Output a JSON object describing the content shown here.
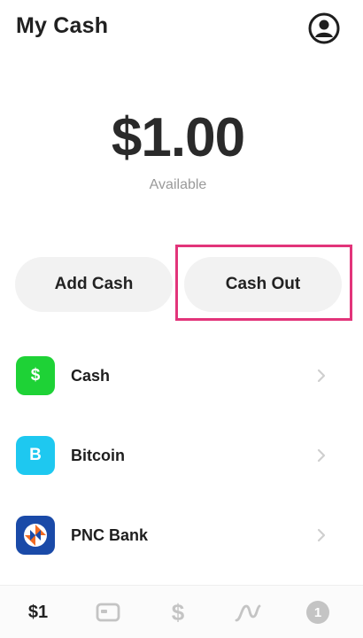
{
  "header": {
    "title": "My Cash",
    "profile_icon": "profile-icon"
  },
  "balance": {
    "amount": "$1.00",
    "label": "Available"
  },
  "actions": {
    "add_cash": "Add Cash",
    "cash_out": "Cash Out",
    "highlight_color": "#e2347a"
  },
  "accounts": [
    {
      "label": "Cash",
      "icon_text": "$",
      "icon": "cash-dollar-icon",
      "color": "#1ed236"
    },
    {
      "label": "Bitcoin",
      "icon_text": "B",
      "icon": "bitcoin-icon",
      "color": "#1ec8f0"
    },
    {
      "label": "PNC Bank",
      "icon_text": "",
      "icon": "pnc-bank-logo-icon",
      "color": "#1a4aa8"
    }
  ],
  "bottom_nav": {
    "balance_tab": "$1",
    "card_tab_icon": "card-icon",
    "pay_tab": "$",
    "investing_tab_icon": "activity-line-icon",
    "activity_badge": "1"
  }
}
